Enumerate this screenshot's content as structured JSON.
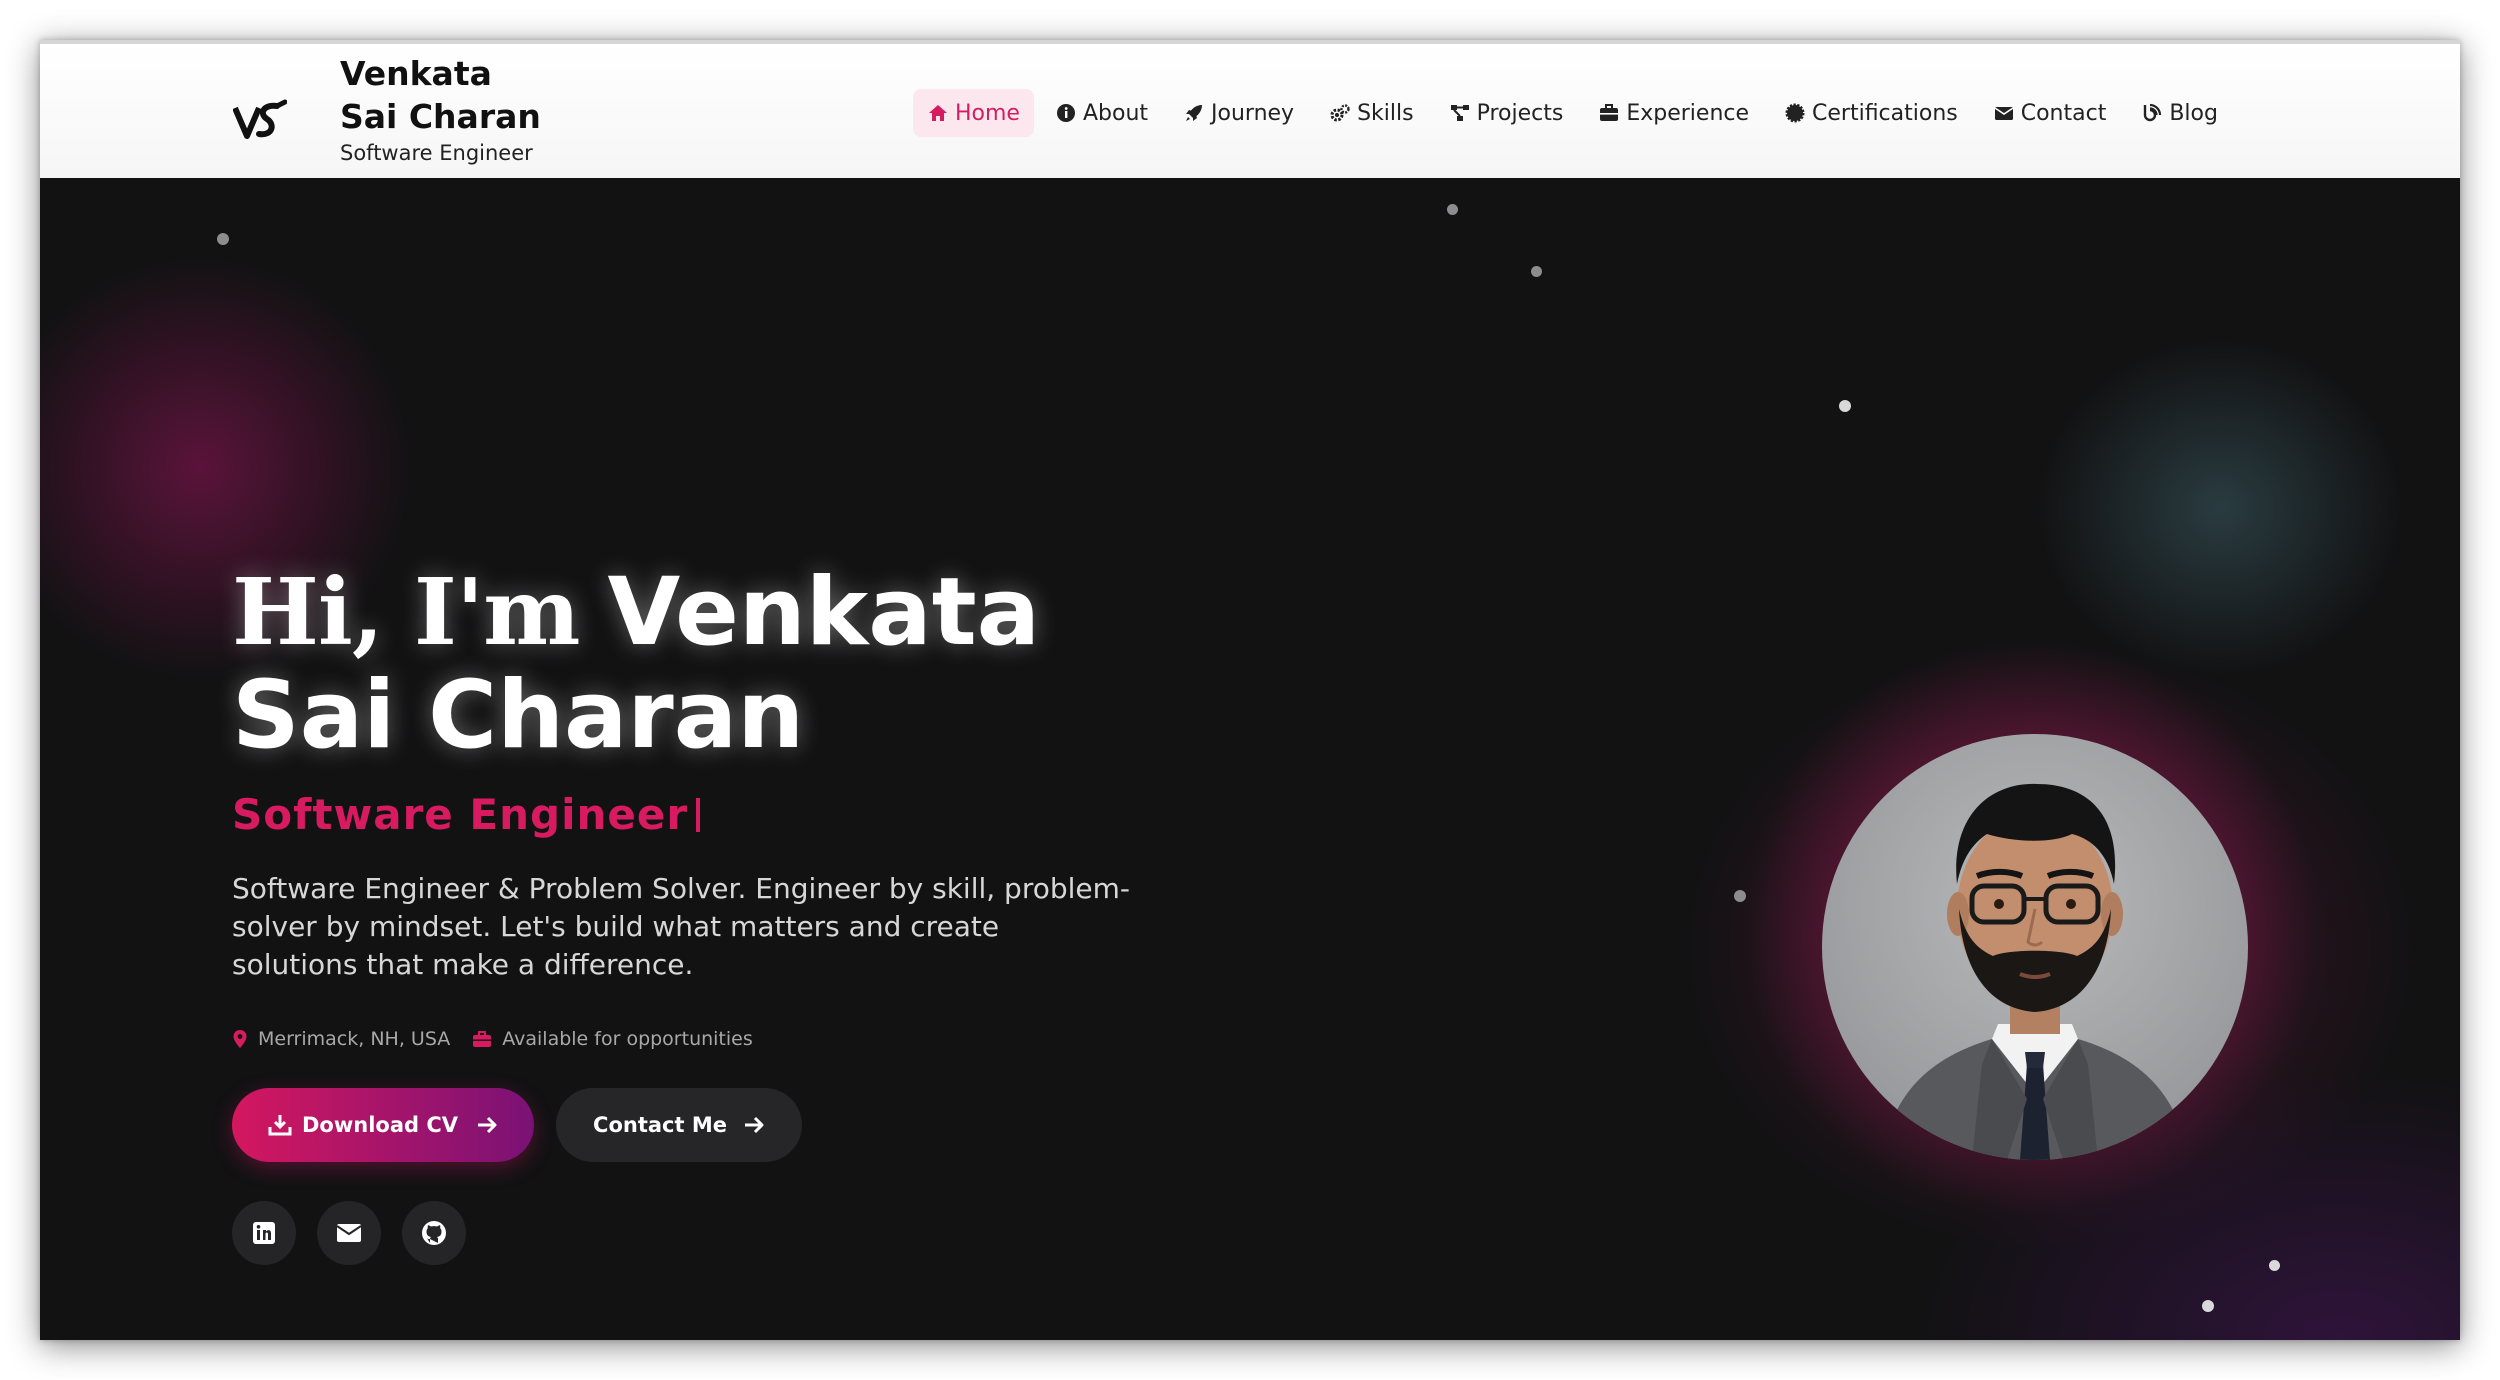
{
  "navbar": {
    "brand_name": "Venkata Sai Charan",
    "brand_role": "Software Engineer",
    "items": [
      {
        "label": "Home",
        "icon": "home-icon",
        "active": true
      },
      {
        "label": "About",
        "icon": "info-icon"
      },
      {
        "label": "Journey",
        "icon": "rocket-icon"
      },
      {
        "label": "Skills",
        "icon": "gears-icon"
      },
      {
        "label": "Projects",
        "icon": "project-diagram-icon"
      },
      {
        "label": "Experience",
        "icon": "briefcase-icon"
      },
      {
        "label": "Certifications",
        "icon": "certificate-icon"
      },
      {
        "label": "Contact",
        "icon": "envelope-icon"
      },
      {
        "label": "Blog",
        "icon": "blog-icon"
      }
    ]
  },
  "hero": {
    "greeting": "Hi, I'm",
    "name_line1": "Venkata",
    "name_line2": "Sai Charan",
    "role": "Software Engineer",
    "description": "Software Engineer & Problem Solver. Engineer by skill, problem-solver by mindset. Let's build what matters and create solutions that make a difference.",
    "location": "Merrimack, NH, USA",
    "availability": "Available for opportunities",
    "download_cv_label": "Download CV",
    "contact_label": "Contact Me",
    "socials": [
      "linkedin-icon",
      "envelope-icon",
      "github-icon"
    ]
  },
  "colors": {
    "accent": "#d81b60",
    "accent_end": "#7a1275",
    "background": "#121213",
    "navbar_bg": "#ffffff",
    "active_nav_bg": "#fde7ee"
  }
}
